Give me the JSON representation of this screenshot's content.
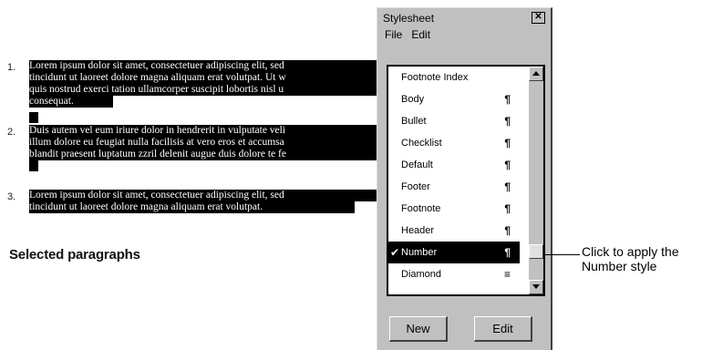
{
  "document": {
    "paragraphs": [
      {
        "number": "1.",
        "lines": [
          "Lorem ipsum dolor sit amet, consectetuer adipiscing elit, sed",
          "tincidunt ut laoreet dolore magna aliquam erat volutpat.  Ut w",
          "quis nostrud exerci tation ullamcorper suscipit lobortis nisl u",
          "consequat."
        ]
      },
      {
        "number": "2.",
        "lines": [
          "Duis autem vel eum iriure dolor in hendrerit in vulputate veli",
          "illum dolore eu feugiat nulla facilisis at vero eros et accumsa",
          "blandit praesent luptatum zzril delenit augue duis dolore te fe"
        ]
      },
      {
        "number": "3.",
        "lines": [
          "Lorem ipsum dolor sit amet, consectetuer adipiscing elit, sed",
          "tincidunt ut laoreet dolore magna aliquam erat volutpat."
        ]
      }
    ],
    "caption": "Selected paragraphs"
  },
  "stylesheet_window": {
    "title": "Stylesheet",
    "close_glyph": "✕",
    "menu": [
      "File",
      "Edit"
    ],
    "styles": [
      {
        "name": "Footnote Index",
        "mark": ""
      },
      {
        "name": "Body",
        "mark": "¶"
      },
      {
        "name": "Bullet",
        "mark": "¶"
      },
      {
        "name": "Checklist",
        "mark": "¶"
      },
      {
        "name": "Default",
        "mark": "¶"
      },
      {
        "name": "Footer",
        "mark": "¶"
      },
      {
        "name": "Footnote",
        "mark": "¶"
      },
      {
        "name": "Header",
        "mark": "¶"
      },
      {
        "name": "Number",
        "mark": "¶",
        "selected": true,
        "checked": true
      },
      {
        "name": "Diamond",
        "mark": "≡"
      }
    ],
    "buttons": {
      "new": "New",
      "edit": "Edit"
    }
  },
  "callout": {
    "line1": "Click to apply the",
    "line2": "Number style"
  }
}
